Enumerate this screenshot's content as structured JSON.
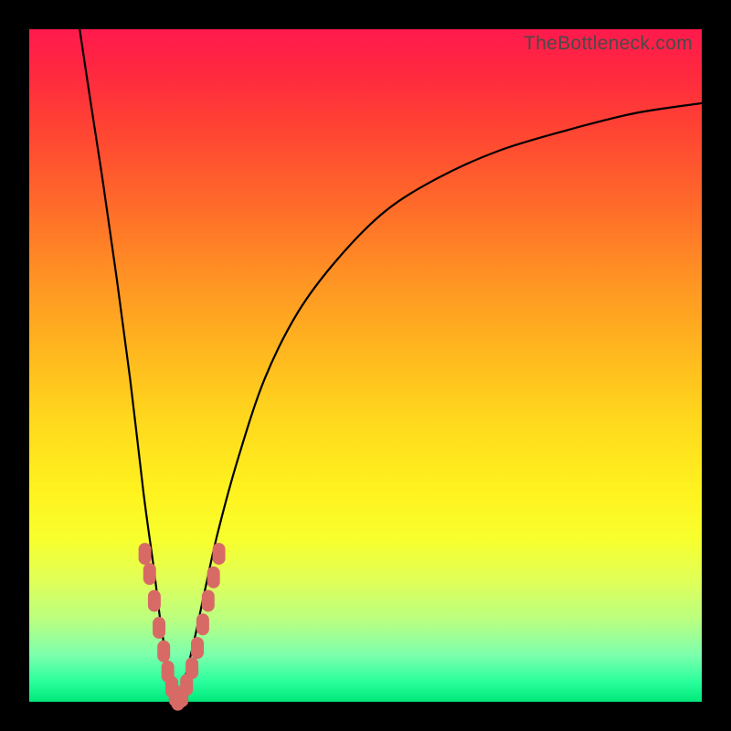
{
  "watermark": "TheBottleneck.com",
  "colors": {
    "marker": "#d86a66",
    "curve": "#000000",
    "frame": "#000000"
  },
  "chart_data": {
    "type": "line",
    "title": "",
    "xlabel": "",
    "ylabel": "",
    "xlim": [
      0,
      100
    ],
    "ylim": [
      0,
      100
    ],
    "grid": false,
    "legend": false,
    "series": [
      {
        "name": "left-branch",
        "x": [
          7.5,
          9,
          11,
          13,
          15,
          17,
          18.5,
          19.5,
          20.3,
          21,
          21.5,
          21.9
        ],
        "y": [
          100,
          90,
          77,
          63,
          48,
          31,
          20,
          12,
          7,
          3,
          1,
          0
        ]
      },
      {
        "name": "right-branch",
        "x": [
          21.9,
          23,
          24.5,
          26,
          28,
          31,
          35,
          40,
          46,
          53,
          61,
          70,
          80,
          90,
          100
        ],
        "y": [
          0,
          3,
          9,
          16,
          25,
          36,
          48,
          58,
          66,
          73,
          78,
          82,
          85,
          87.5,
          89
        ]
      }
    ],
    "markers": {
      "name": "cluster",
      "shape": "rounded-capsule",
      "color": "#d86a66",
      "points": [
        {
          "x": 17.2,
          "y": 22
        },
        {
          "x": 17.9,
          "y": 19
        },
        {
          "x": 18.6,
          "y": 15
        },
        {
          "x": 19.3,
          "y": 11
        },
        {
          "x": 20.0,
          "y": 7.5
        },
        {
          "x": 20.6,
          "y": 4.5
        },
        {
          "x": 21.2,
          "y": 2.2
        },
        {
          "x": 21.7,
          "y": 0.9
        },
        {
          "x": 22.1,
          "y": 0.3
        },
        {
          "x": 22.7,
          "y": 0.8
        },
        {
          "x": 23.4,
          "y": 2.5
        },
        {
          "x": 24.2,
          "y": 5
        },
        {
          "x": 25.0,
          "y": 8
        },
        {
          "x": 25.8,
          "y": 11.5
        },
        {
          "x": 26.6,
          "y": 15
        },
        {
          "x": 27.4,
          "y": 18.5
        },
        {
          "x": 28.2,
          "y": 22
        }
      ]
    }
  }
}
